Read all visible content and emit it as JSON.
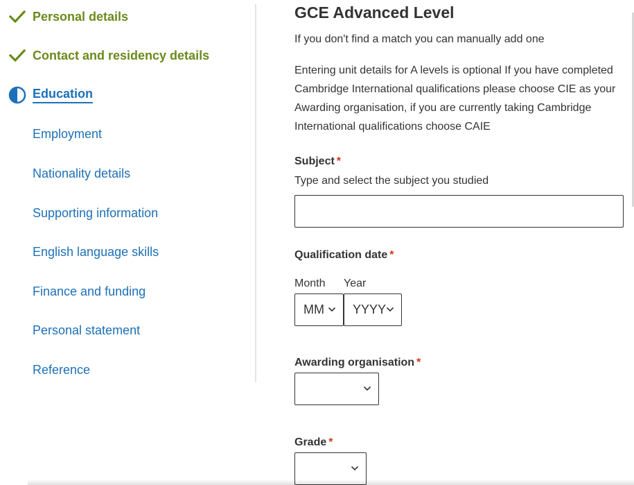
{
  "sidebar": {
    "items": [
      {
        "label": "Personal details",
        "status": "done"
      },
      {
        "label": "Contact and residency details",
        "status": "done"
      },
      {
        "label": "Education",
        "status": "current"
      },
      {
        "label": "Employment",
        "status": "todo"
      },
      {
        "label": "Nationality details",
        "status": "todo"
      },
      {
        "label": "Supporting information",
        "status": "todo"
      },
      {
        "label": "English language skills",
        "status": "todo"
      },
      {
        "label": "Finance and funding",
        "status": "todo"
      },
      {
        "label": "Personal statement",
        "status": "todo"
      },
      {
        "label": "Reference",
        "status": "todo"
      }
    ]
  },
  "main": {
    "title": "GCE Advanced Level",
    "intro": "If you don't find a match you can manually add one",
    "help": "Entering unit details for A levels is optional If you have completed Cambridge International qualifications please choose CIE as your Awarding organisation, if you are currently taking Cambridge International qualifications choose CAIE",
    "required_marker": "*",
    "subject": {
      "label": "Subject",
      "hint": "Type and select the subject you studied",
      "value": ""
    },
    "qualification_date": {
      "label": "Qualification date",
      "month_label": "Month",
      "year_label": "Year",
      "month_value": "MM",
      "year_value": "YYYY"
    },
    "awarding_organisation": {
      "label": "Awarding organisation",
      "value": ""
    },
    "grade": {
      "label": "Grade",
      "value": ""
    }
  },
  "colors": {
    "done": "#6a8a1b",
    "link": "#1d70b8",
    "required": "#d4351c",
    "text": "#333333"
  },
  "icons": {
    "done": "check-icon",
    "current": "half-circle-icon",
    "select": "chevron-down-icon"
  }
}
